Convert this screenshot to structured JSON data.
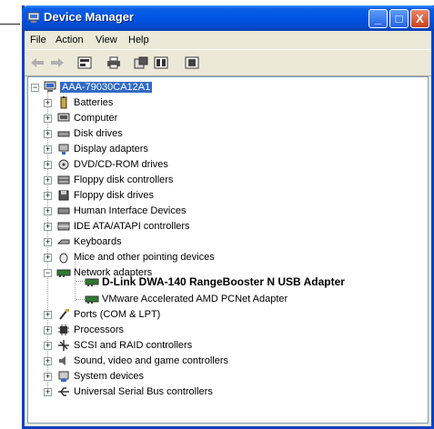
{
  "window": {
    "title": "Device Manager",
    "buttons": {
      "minimize": "_",
      "maximize": "□",
      "close": "X"
    }
  },
  "menu": [
    "File",
    "Action",
    "View",
    "Help"
  ],
  "toolbar": [
    "back-icon",
    "forward-icon",
    "properties-icon",
    "print-icon",
    "update-driver-icon",
    "scan-icon",
    "help-icon"
  ],
  "tree": {
    "root": "AAA-79030CA12A1",
    "categories": [
      "Batteries",
      "Computer",
      "Disk drives",
      "Display adapters",
      "DVD/CD-ROM drives",
      "Floppy disk controllers",
      "Floppy disk drives",
      "Human Interface Devices",
      "IDE ATA/ATAPI controllers",
      "Keyboards",
      "Mice and other pointing devices",
      "Network adapters",
      "Ports (COM & LPT)",
      "Processors",
      "SCSI and RAID controllers",
      "Sound, video and game controllers",
      "System devices",
      "Universal Serial Bus controllers"
    ],
    "network_children": [
      "D-Link DWA-140 RangeBooster N USB Adapter",
      "VMware Accelerated AMD PCNet Adapter"
    ],
    "expand_symbol": "+",
    "collapse_symbol": "−"
  },
  "colors": {
    "titlebar": "#0055e5",
    "selection": "#316ac5",
    "window_bg": "#ece9d8"
  }
}
